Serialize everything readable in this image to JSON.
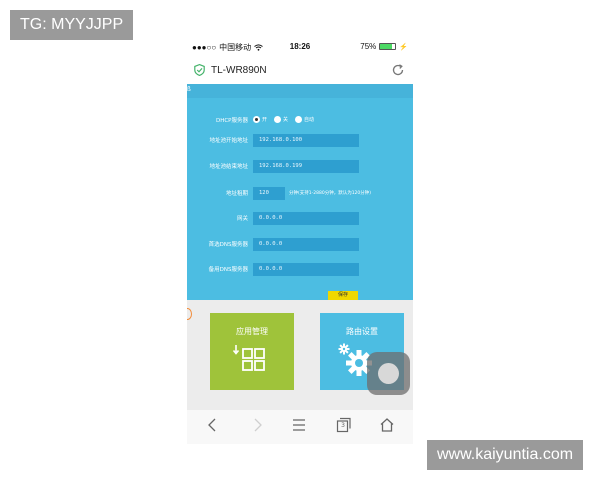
{
  "watermark": {
    "top_left": "TG: MYYJJPP",
    "bottom_right": "www.kaiyuntia.com"
  },
  "status_bar": {
    "signal": "●●●○○",
    "carrier": "中国移动",
    "time": "18:26",
    "battery_text": "75%",
    "battery_level": 0.75
  },
  "app_bar": {
    "title": "TL-WR890N",
    "shield_icon": "shield-check-icon",
    "refresh_icon": "refresh-icon"
  },
  "panel": {
    "corner_mark": "ß",
    "dhcp": {
      "label": "DHCP服务器",
      "options": [
        {
          "label": "开",
          "selected": true
        },
        {
          "label": "关",
          "selected": false
        },
        {
          "label": "自动",
          "selected": false
        }
      ]
    },
    "start_address": {
      "label": "地址池开始地址",
      "value": "192.168.0.100"
    },
    "end_address": {
      "label": "地址池结束地址",
      "value": "192.168.0.199"
    },
    "lease": {
      "label": "地址租期",
      "value": "120",
      "hint": "分钟(支持1-2880分钟，默认为120分钟)"
    },
    "gateway": {
      "label": "网关",
      "value": "0.0.0.0"
    },
    "primary_dns": {
      "label": "首选DNS服务器",
      "value": "0.0.0.0"
    },
    "secondary_dns": {
      "label": "备用DNS服务器",
      "value": "0.0.0.0"
    },
    "save_label": "保存"
  },
  "tiles": {
    "apps": {
      "label": "应用管理",
      "icon": "grid-download-icon",
      "color": "#9fc33a"
    },
    "router": {
      "label": "路由设置",
      "icon": "gear-icon",
      "color": "#4cbde2"
    }
  },
  "nav_bar": {
    "icons": [
      "back-icon",
      "forward-icon",
      "menu-icon",
      "tabs-icon",
      "home-icon"
    ],
    "tabs_count": "3"
  },
  "colors": {
    "panel": "#4cbde2",
    "field": "#2e9fd0",
    "save": "#f0d800"
  }
}
